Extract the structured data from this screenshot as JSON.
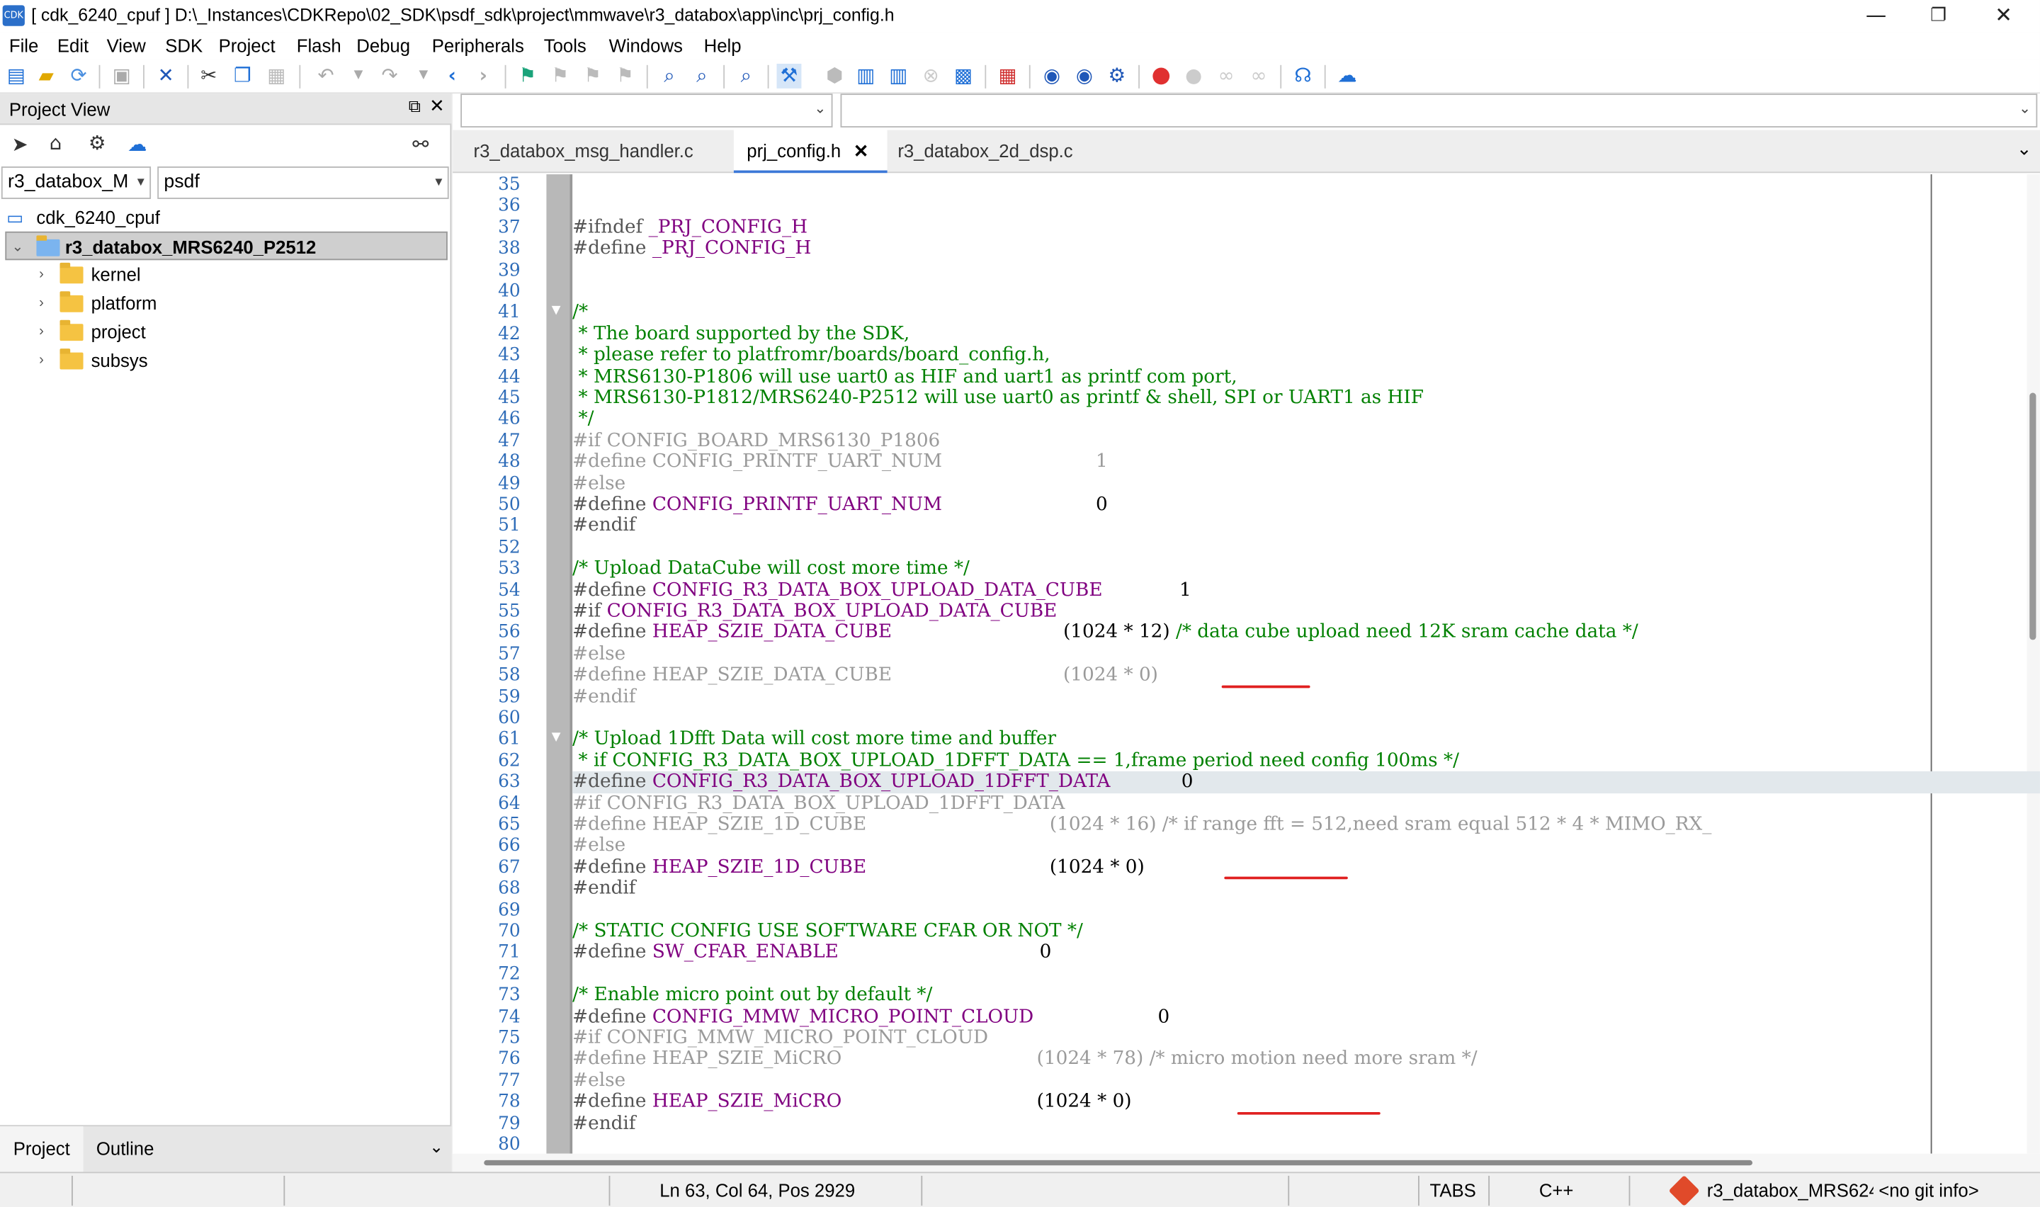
{
  "window": {
    "title": "[ cdk_6240_cpuf ] D:\\_Instances\\CDKRepo\\02_SDK\\psdf_sdk\\project\\mmwave\\r3_databox\\app\\inc\\prj_config.h",
    "logo_text": "CDK",
    "minimize": "—",
    "restore": "❐",
    "close": "✕"
  },
  "menu": [
    "File",
    "Edit",
    "View",
    "SDK",
    "Project",
    "Flash",
    "Debug",
    "Peripherals",
    "Tools",
    "Windows",
    "Help"
  ],
  "project_view": {
    "title": "Project View",
    "solution_combo": "r3_databox_M",
    "target_combo": "psdf",
    "workspace": "cdk_6240_cpuf",
    "project": "r3_databox_MRS6240_P2512",
    "folders": [
      "kernel",
      "platform",
      "project",
      "subsys"
    ],
    "bottom_tabs": [
      "Project",
      "Outline"
    ]
  },
  "editor": {
    "tabs": [
      {
        "label": "r3_databox_msg_handler.c",
        "active": false
      },
      {
        "label": "prj_config.h",
        "active": true,
        "close": "✕"
      },
      {
        "label": "r3_databox_2d_dsp.c",
        "active": false
      }
    ],
    "current_line": 63,
    "lines": [
      {
        "n": "35",
        "parts": []
      },
      {
        "n": "36",
        "parts": []
      },
      {
        "n": "37",
        "parts": [
          [
            "k",
            "#ifndef "
          ],
          [
            "m",
            "_PRJ_CONFIG_H"
          ]
        ]
      },
      {
        "n": "38",
        "parts": [
          [
            "k",
            "#define "
          ],
          [
            "m",
            "_PRJ_CONFIG_H"
          ]
        ]
      },
      {
        "n": "39",
        "parts": []
      },
      {
        "n": "40",
        "parts": []
      },
      {
        "n": "41",
        "parts": [
          [
            "c",
            "/*"
          ]
        ]
      },
      {
        "n": "42",
        "parts": [
          [
            "c",
            " * The board supported by the SDK,"
          ]
        ]
      },
      {
        "n": "43",
        "parts": [
          [
            "c",
            " * please refer to platfromr/boards/board_config.h,"
          ]
        ]
      },
      {
        "n": "44",
        "parts": [
          [
            "c",
            " * MRS6130-P1806 will use uart0 as HIF and uart1 as printf com port,"
          ]
        ]
      },
      {
        "n": "45",
        "parts": [
          [
            "c",
            " * MRS6130-P1812/MRS6240-P2512 will use uart0 as printf & shell, SPI or UART1 as HIF"
          ]
        ]
      },
      {
        "n": "46",
        "parts": [
          [
            "c",
            " */"
          ]
        ]
      },
      {
        "n": "47",
        "parts": [
          [
            "d",
            "#if CONFIG_BOARD_MRS6130_P1806"
          ]
        ]
      },
      {
        "n": "48",
        "parts": [
          [
            "d",
            "#define CONFIG_PRINTF_UART_NUM                          1"
          ]
        ]
      },
      {
        "n": "49",
        "parts": [
          [
            "d",
            "#else"
          ]
        ]
      },
      {
        "n": "50",
        "parts": [
          [
            "k",
            "#define "
          ],
          [
            "m",
            "CONFIG_PRINTF_UART_NUM"
          ],
          [
            "n",
            "                          0"
          ]
        ]
      },
      {
        "n": "51",
        "parts": [
          [
            "k",
            "#endif"
          ]
        ]
      },
      {
        "n": "52",
        "parts": []
      },
      {
        "n": "53",
        "parts": [
          [
            "c",
            "/* Upload DataCube will cost more time */"
          ]
        ]
      },
      {
        "n": "54",
        "parts": [
          [
            "k",
            "#define "
          ],
          [
            "m",
            "CONFIG_R3_DATA_BOX_UPLOAD_DATA_CUBE"
          ],
          [
            "n",
            "             1"
          ]
        ]
      },
      {
        "n": "55",
        "parts": [
          [
            "k",
            "#if "
          ],
          [
            "m",
            "CONFIG_R3_DATA_BOX_UPLOAD_DATA_CUBE"
          ]
        ]
      },
      {
        "n": "56",
        "parts": [
          [
            "k",
            "#define "
          ],
          [
            "m",
            "HEAP_SZIE_DATA_CUBE"
          ],
          [
            "n",
            "                             (1024 * 12) "
          ],
          [
            "c",
            "/* data cube upload need 12K sram cache data */"
          ]
        ]
      },
      {
        "n": "57",
        "parts": [
          [
            "d",
            "#else"
          ]
        ]
      },
      {
        "n": "58",
        "parts": [
          [
            "d",
            "#define HEAP_SZIE_DATA_CUBE                             (1024 * 0)"
          ]
        ]
      },
      {
        "n": "59",
        "parts": [
          [
            "d",
            "#endif"
          ]
        ]
      },
      {
        "n": "60",
        "parts": []
      },
      {
        "n": "61",
        "parts": [
          [
            "c",
            "/* Upload 1Dfft Data will cost more time and buffer"
          ]
        ]
      },
      {
        "n": "62",
        "parts": [
          [
            "c",
            " * if CONFIG_R3_DATA_BOX_UPLOAD_1DFFT_DATA == 1,frame period need config 100ms */"
          ]
        ]
      },
      {
        "n": "63",
        "parts": [
          [
            "k",
            "#define "
          ],
          [
            "m",
            "CONFIG_R3_DATA_BOX_UPLOAD_1DFFT_DATA"
          ],
          [
            "n",
            "            0"
          ]
        ]
      },
      {
        "n": "64",
        "parts": [
          [
            "d",
            "#if CONFIG_R3_DATA_BOX_UPLOAD_1DFFT_DATA"
          ]
        ]
      },
      {
        "n": "65",
        "parts": [
          [
            "d",
            "#define HEAP_SZIE_1D_CUBE                               (1024 * 16) /* if range fft = 512,need sram equal 512 * 4 * MIMO_RX_"
          ]
        ]
      },
      {
        "n": "66",
        "parts": [
          [
            "d",
            "#else"
          ]
        ]
      },
      {
        "n": "67",
        "parts": [
          [
            "k",
            "#define "
          ],
          [
            "m",
            "HEAP_SZIE_1D_CUBE"
          ],
          [
            "n",
            "                               (1024 * 0)"
          ]
        ]
      },
      {
        "n": "68",
        "parts": [
          [
            "k",
            "#endif"
          ]
        ]
      },
      {
        "n": "69",
        "parts": []
      },
      {
        "n": "70",
        "parts": [
          [
            "c",
            "/* STATIC CONFIG USE SOFTWARE CFAR OR NOT */"
          ]
        ]
      },
      {
        "n": "71",
        "parts": [
          [
            "k",
            "#define "
          ],
          [
            "m",
            "SW_CFAR_ENABLE"
          ],
          [
            "n",
            "                                  0"
          ]
        ]
      },
      {
        "n": "72",
        "parts": []
      },
      {
        "n": "73",
        "parts": [
          [
            "c",
            "/* Enable micro point out by default */"
          ]
        ]
      },
      {
        "n": "74",
        "parts": [
          [
            "k",
            "#define "
          ],
          [
            "m",
            "CONFIG_MMW_MICRO_POINT_CLOUD"
          ],
          [
            "n",
            "                     0"
          ]
        ]
      },
      {
        "n": "75",
        "parts": [
          [
            "d",
            "#if CONFIG_MMW_MICRO_POINT_CLOUD"
          ]
        ]
      },
      {
        "n": "76",
        "parts": [
          [
            "d",
            "#define HEAP_SZIE_MiCRO                                 (1024 * 78) /* micro motion need more sram */"
          ]
        ]
      },
      {
        "n": "77",
        "parts": [
          [
            "d",
            "#else"
          ]
        ]
      },
      {
        "n": "78",
        "parts": [
          [
            "k",
            "#define "
          ],
          [
            "m",
            "HEAP_SZIE_MiCRO"
          ],
          [
            "n",
            "                                 (1024 * 0)"
          ]
        ]
      },
      {
        "n": "79",
        "parts": [
          [
            "k",
            "#endif"
          ]
        ]
      },
      {
        "n": "80",
        "parts": []
      }
    ]
  },
  "status": {
    "position": "Ln 63, Col 64, Pos 2929",
    "tabs": "TABS",
    "language": "C++",
    "git_project": "r3_databox_MRS624",
    "git_info": "<no git info>"
  },
  "colors": {
    "keyword": "#555555",
    "macro": "#800080",
    "comment": "#008000",
    "disabled": "#9a9a9a",
    "line_number": "#2e6cb8",
    "annotation": "#e02020",
    "accent": "#3c78d8"
  }
}
